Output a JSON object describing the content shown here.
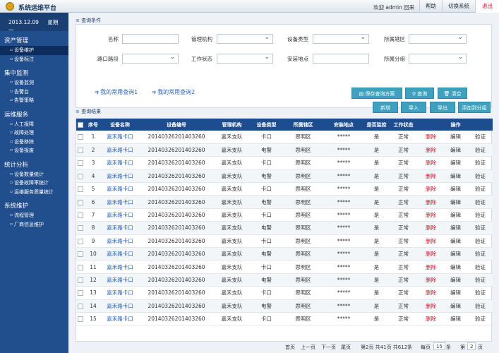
{
  "header": {
    "title": "系统运维平台",
    "welcome": "欢迎 admin 回来",
    "help": "帮助",
    "switch": "切换系统",
    "logout": "退出"
  },
  "sidebar": {
    "date": "2013.12.09",
    "weekday": "星期一",
    "groups": [
      {
        "title": "资产管理",
        "items": [
          "设备维护",
          "设备标注"
        ]
      },
      {
        "title": "集中监测",
        "items": [
          "设备监测",
          "告警台",
          "告警策略"
        ]
      },
      {
        "title": "运维服务",
        "items": [
          "人工报障",
          "故障处理",
          "设备移除",
          "设备报废"
        ]
      },
      {
        "title": "统计分析",
        "items": [
          "设备数量统计",
          "设备故障率统计",
          "运维服务质量统计"
        ]
      },
      {
        "title": "系统维护",
        "items": [
          "流程管理",
          "厂商信息维护"
        ]
      }
    ]
  },
  "query": {
    "section": "查询条件",
    "labels": [
      "名称",
      "管理机构",
      "设备类型",
      "所属辖区",
      "路口路段",
      "工作状态",
      "安装地点",
      "所属分组"
    ],
    "saved": [
      "我的常用查询1",
      "我的常用查询2"
    ],
    "save_btn": "保存查询方案",
    "search_btn": "查询",
    "clear_btn": "清空"
  },
  "results": {
    "section": "查询结果",
    "add": "新增",
    "import": "导入",
    "export": "导出",
    "add_group": "添加到分组",
    "columns": [
      "序号",
      "设备名称",
      "设备编号",
      "管理机构",
      "设备类型",
      "所属辖区",
      "安装地点",
      "是否监控",
      "工作状态",
      "操作"
    ],
    "rows": [
      [
        "1",
        "嘉禾路卡口",
        "20140326201403260",
        "嘉禾支队",
        "卡口",
        "思明区",
        "*****",
        "是",
        "正常"
      ],
      [
        "2",
        "嘉禾路卡口",
        "20140326201403260",
        "嘉禾支队",
        "电警",
        "思明区",
        "*****",
        "是",
        "正常"
      ],
      [
        "3",
        "嘉禾路卡口",
        "20140326201403260",
        "嘉禾支队",
        "卡口",
        "思明区",
        "*****",
        "是",
        "正常"
      ],
      [
        "4",
        "嘉禾路卡口",
        "20140326201403260",
        "嘉禾支队",
        "电警",
        "思明区",
        "*****",
        "是",
        "正常"
      ],
      [
        "5",
        "嘉禾路卡口",
        "20140326201403260",
        "嘉禾支队",
        "卡口",
        "思明区",
        "*****",
        "是",
        "正常"
      ],
      [
        "6",
        "嘉禾路卡口",
        "20140326201403260",
        "嘉禾支队",
        "电警",
        "思明区",
        "*****",
        "是",
        "正常"
      ],
      [
        "7",
        "嘉禾路卡口",
        "20140326201403260",
        "嘉禾支队",
        "卡口",
        "思明区",
        "*****",
        "是",
        "正常"
      ],
      [
        "8",
        "嘉禾路卡口",
        "20140326201403260",
        "嘉禾支队",
        "电警",
        "思明区",
        "*****",
        "是",
        "正常"
      ],
      [
        "9",
        "嘉禾路卡口",
        "20140326201403260",
        "嘉禾支队",
        "卡口",
        "思明区",
        "*****",
        "是",
        "正常"
      ],
      [
        "10",
        "嘉禾路卡口",
        "20140326201403260",
        "嘉禾支队",
        "电警",
        "思明区",
        "*****",
        "是",
        "正常"
      ],
      [
        "11",
        "嘉禾路卡口",
        "20140326201403260",
        "嘉禾支队",
        "卡口",
        "思明区",
        "*****",
        "是",
        "正常"
      ],
      [
        "12",
        "嘉禾路卡口",
        "20140326201403260",
        "嘉禾支队",
        "电警",
        "思明区",
        "*****",
        "是",
        "正常"
      ],
      [
        "13",
        "嘉禾路卡口",
        "20140326201403260",
        "嘉禾支队",
        "卡口",
        "思明区",
        "*****",
        "是",
        "正常"
      ],
      [
        "14",
        "嘉禾路卡口",
        "20140326201403260",
        "嘉禾支队",
        "电警",
        "思明区",
        "*****",
        "是",
        "正常"
      ],
      [
        "15",
        "嘉禾路卡口",
        "20140326201403260",
        "嘉禾支队",
        "卡口",
        "思明区",
        "*****",
        "是",
        "正常"
      ]
    ],
    "actions": [
      "删除",
      "编辑",
      "验证"
    ]
  },
  "pager": {
    "first": "首页",
    "prev": "上一页",
    "next": "下一页",
    "last": "尾页",
    "info": "第2页 共41页 共612条",
    "per_page_pre": "每页",
    "per_page": "15",
    "per_page_post": "条",
    "goto_pre": "第",
    "goto": "2",
    "goto_post": "页"
  }
}
